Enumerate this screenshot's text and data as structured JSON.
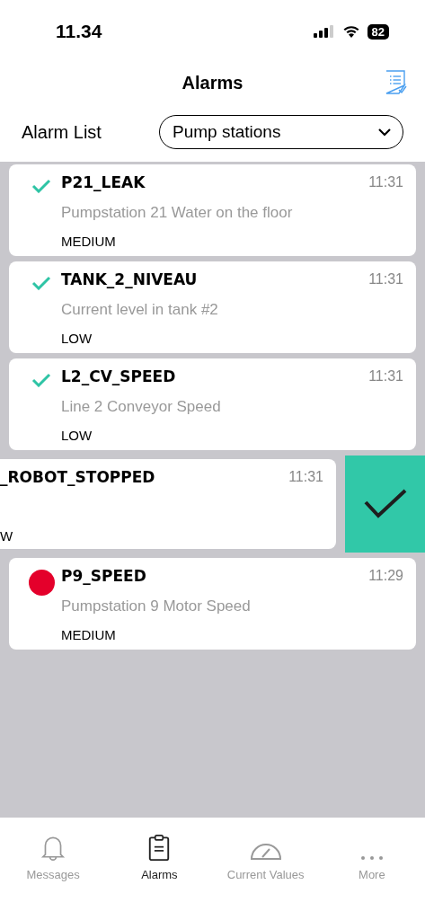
{
  "status_bar": {
    "time": "11.34",
    "battery": "82"
  },
  "header": {
    "title": "Alarms"
  },
  "filter": {
    "label": "Alarm List",
    "value": "Pump stations"
  },
  "alarms": [
    {
      "kind": "acknowledged",
      "name": "P21_LEAK",
      "time": "11:31",
      "description": "Pumpstation 21 Water on the floor",
      "severity": "MEDIUM"
    },
    {
      "kind": "acknowledged",
      "name": "TANK_2_NIVEAU",
      "time": "11:31",
      "description": "Current level in tank #2",
      "severity": "LOW"
    },
    {
      "kind": "acknowledged",
      "name": "L2_CV_SPEED",
      "time": "11:31",
      "description": "Line 2 Conveyor Speed",
      "severity": "LOW"
    },
    {
      "kind": "swiped",
      "name": "_ROBOT_STOPPED",
      "time": "11:31",
      "severity": "W"
    },
    {
      "kind": "active",
      "name": "P9_SPEED",
      "time": "11:29",
      "description": "Pumpstation 9 Motor Speed",
      "severity": "MEDIUM",
      "color": "#e4002b"
    }
  ],
  "tabs": [
    {
      "label": "Messages",
      "kind": "bell",
      "selected": false
    },
    {
      "label": "Alarms",
      "kind": "clipboard",
      "selected": true
    },
    {
      "label": "Current Values",
      "kind": "gauge",
      "selected": false
    },
    {
      "label": "More",
      "kind": "dots",
      "selected": false
    }
  ]
}
